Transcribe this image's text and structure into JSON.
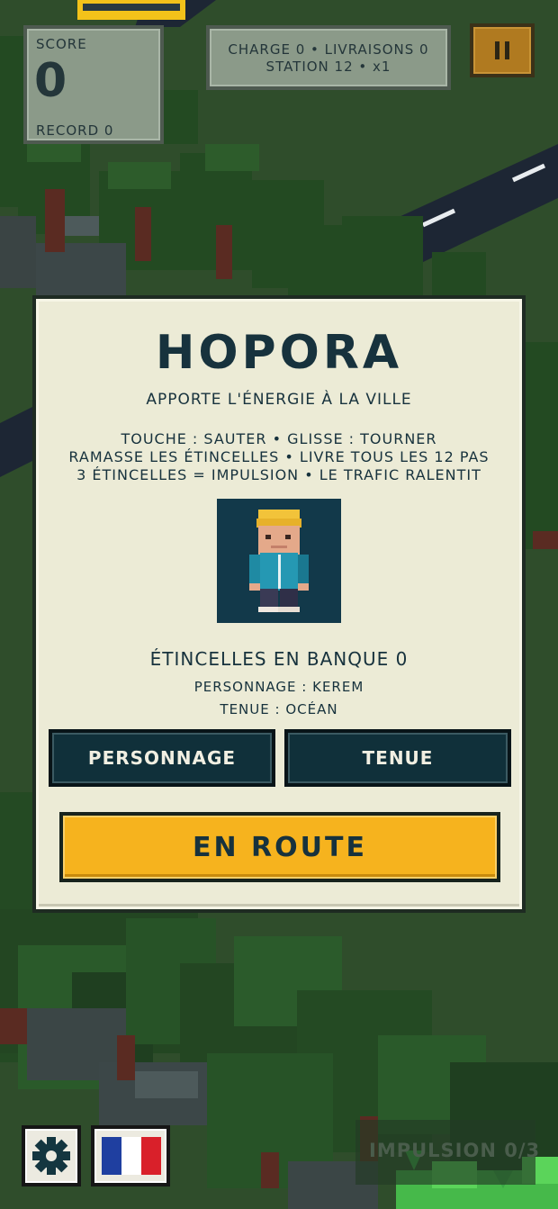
{
  "hud": {
    "score_label": "SCORE",
    "score_value": "0",
    "record_line": "RECORD  0",
    "stats_line1": "CHARGE 0   •   LIVRAISONS 0",
    "stats_line2": "STATION 12   •   x1"
  },
  "menu": {
    "title": "HOPORA",
    "subtitle": "APPORTE L'ÉNERGIE À LA VILLE",
    "rules": [
      "TOUCHE : SAUTER  •  GLISSE : TOURNER",
      "RAMASSE LES ÉTINCELLES  •  LIVRE TOUS LES 12 PAS",
      "3 ÉTINCELLES = IMPULSION  •  LE TRAFIC RALENTIT"
    ],
    "bank_line": "ÉTINCELLES EN BANQUE  0",
    "character_line": "PERSONNAGE : KEREM",
    "outfit_line": "TENUE : OCÉAN",
    "character_button": "PERSONNAGE",
    "outfit_button": "TENUE",
    "start_button": "EN ROUTE"
  },
  "footer": {
    "pulse_label": "IMPULSION 0/3"
  },
  "icons": {
    "pause": "pause-icon",
    "settings": "gear-icon",
    "language": "french-flag-icon",
    "avatar": "character-avatar"
  },
  "colors": {
    "panel_bg": "#ecebd6",
    "title": "#17323d",
    "start_button": "#f6b31e",
    "dark_button": "#10303a",
    "hud_panel": "#8b9a89",
    "pause_button": "#b07a20"
  }
}
